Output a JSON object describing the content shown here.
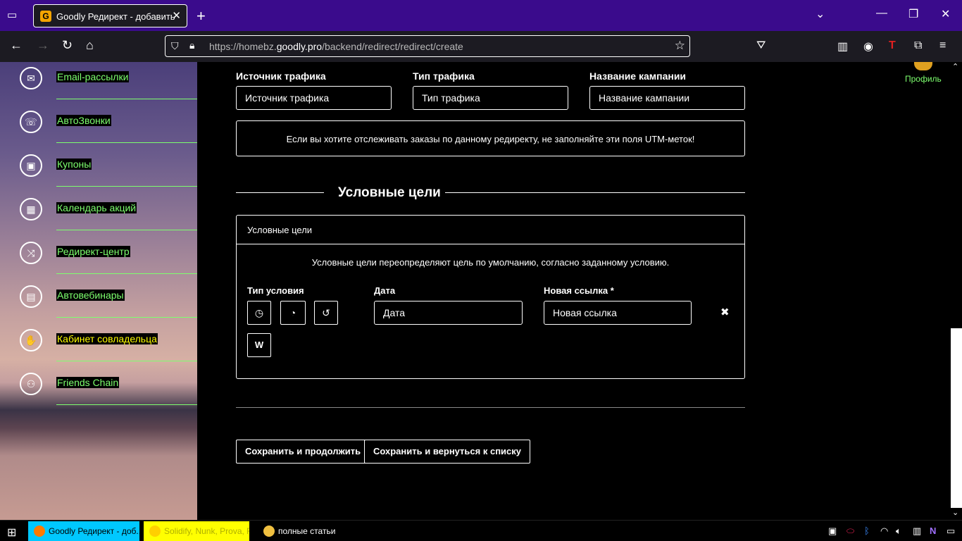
{
  "browser": {
    "tab_title": "Goodly Редирект - добавить",
    "tab_favicon_letter": "G",
    "url_dim_prefix": "https://homebz.",
    "url_domain": "goodly.pro",
    "url_path": "/backend/redirect/redirect/create"
  },
  "sidebar": {
    "items": [
      {
        "label": "Email-рассылки",
        "icon": "mail-icon",
        "glyph": "✉"
      },
      {
        "label": "АвтоЗвонки",
        "icon": "phone-icon",
        "glyph": "☏"
      },
      {
        "label": "Купоны",
        "icon": "coupon-icon",
        "glyph": "▣"
      },
      {
        "label": "Календарь акций",
        "icon": "calendar-icon",
        "glyph": "▦"
      },
      {
        "label": "Редирект-центр",
        "icon": "shuffle-icon",
        "glyph": "⤨"
      },
      {
        "label": "Автовебинары",
        "icon": "id-card-icon",
        "glyph": "▤"
      },
      {
        "label": "Кабинет совладельца",
        "icon": "handshake-icon",
        "glyph": "✋"
      },
      {
        "label": "Friends Chain",
        "icon": "friends-icon",
        "glyph": "⚇"
      }
    ]
  },
  "utm": {
    "source_label": "Источник трафика",
    "source_placeholder": "Источник трафика",
    "type_label": "Тип трафика",
    "type_placeholder": "Тип трафика",
    "campaign_label": "Название кампании",
    "campaign_placeholder": "Название кампании",
    "notice": "Если вы хотите отслеживать заказы по данному редиректу, не заполняйте эти поля UTM-меток!"
  },
  "conditional": {
    "section_title": "Условные цели",
    "panel_title": "Условные цели",
    "description": "Условные цели переопределяют цель по умолчанию, согласно заданному условию.",
    "condition_type_label": "Тип условия",
    "date_label": "Дата",
    "date_placeholder": "Дата",
    "new_link_label": "Новая ссылка *",
    "new_link_placeholder": "Новая ссылка",
    "type_buttons": [
      "◷",
      "◔",
      "↺",
      "W"
    ],
    "delete_glyph": "✖"
  },
  "actions": {
    "save_continue": "Сохранить и продолжить",
    "save_return": "Сохранить и вернуться к списку"
  },
  "profile": {
    "label": "Профиль"
  },
  "taskbar": {
    "tasks": [
      {
        "label": "Goodly Редирект - доб...",
        "bg": "#00c8ff",
        "color": "#000"
      },
      {
        "label": "Solidify, Nunk, Prova, R...",
        "bg": "#ffff00",
        "color": "#b0b000"
      },
      {
        "label": "полные статьи",
        "bg": "#000",
        "color": "#fff"
      }
    ]
  },
  "colors": {
    "accent_green": "#7dff6e",
    "tab_bar": "#3a0b8c"
  }
}
